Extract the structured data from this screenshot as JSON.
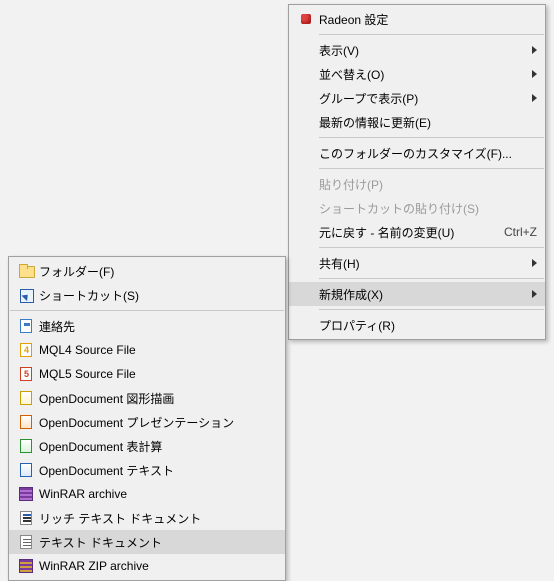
{
  "main_menu": {
    "radeon": "Radeon 設定",
    "view": "表示(V)",
    "sort": "並べ替え(O)",
    "group": "グループで表示(P)",
    "refresh": "最新の情報に更新(E)",
    "customize": "このフォルダーのカスタマイズ(F)...",
    "paste": "貼り付け(P)",
    "paste_shortcut": "ショートカットの貼り付け(S)",
    "undo": "元に戻す - 名前の変更(U)",
    "undo_shortcut": "Ctrl+Z",
    "share": "共有(H)",
    "new": "新規作成(X)",
    "properties": "プロパティ(R)"
  },
  "sub_menu": {
    "folder": "フォルダー(F)",
    "shortcut": "ショートカット(S)",
    "contact": "連絡先",
    "mql4": "MQL4 Source File",
    "mql5": "MQL5 Source File",
    "od_draw": "OpenDocument 図形描画",
    "od_pres": "OpenDocument プレゼンテーション",
    "od_calc": "OpenDocument 表計算",
    "od_text": "OpenDocument テキスト",
    "winrar": "WinRAR archive",
    "rtf": "リッチ テキスト ドキュメント",
    "txt": "テキスト ドキュメント",
    "winrar_zip": "WinRAR ZIP archive"
  }
}
